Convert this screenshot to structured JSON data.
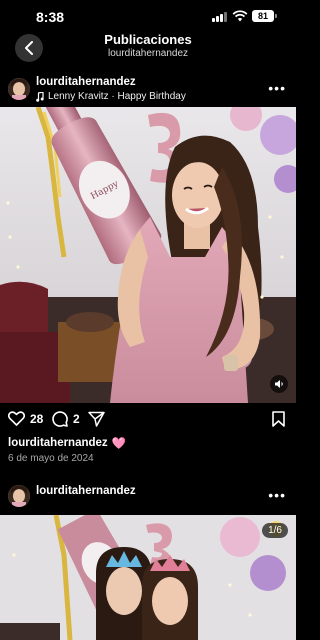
{
  "status_bar": {
    "time": "8:38",
    "battery": "81"
  },
  "header": {
    "title": "Publicaciones",
    "subtitle": "lourditahernandez"
  },
  "post": {
    "username": "lourditahernandez",
    "music": "Lenny Kravitz · Happy Birthday",
    "likes": "28",
    "comments": "2",
    "caption_user": "lourditahernandez",
    "caption_emoji": "🩷",
    "date": "6 de mayo de 2024"
  },
  "next_post": {
    "username": "lourditahernandez",
    "counter": "1/6"
  },
  "colors": {
    "background": "#000000",
    "secondary_text": "#a8a8a8",
    "heart": "#ff5fa8"
  }
}
